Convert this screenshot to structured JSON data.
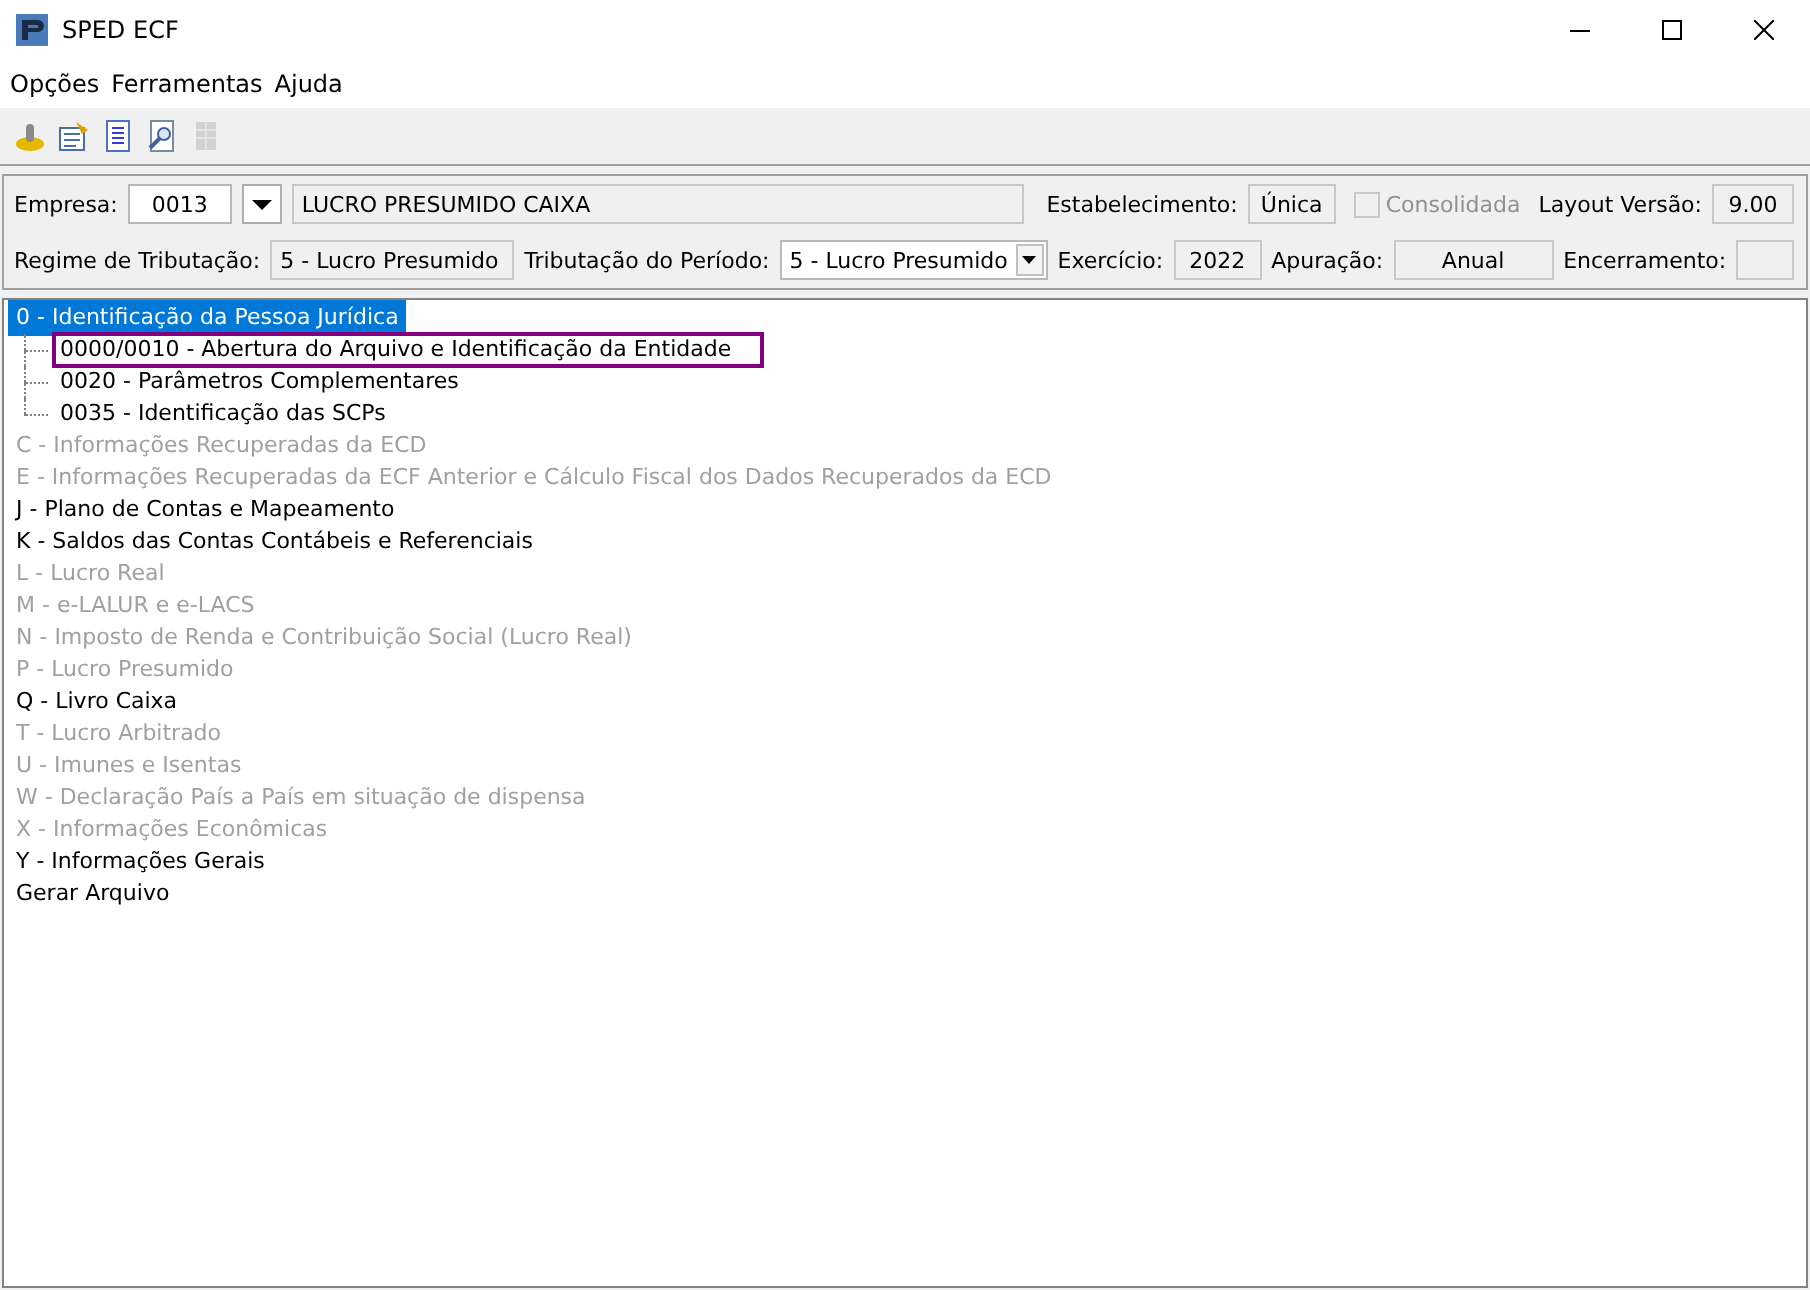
{
  "window": {
    "title": "SPED ECF"
  },
  "menu": [
    "Opções",
    "Ferramentas",
    "Ajuda"
  ],
  "toolbar": [
    {
      "disabled": false
    },
    {
      "disabled": false
    },
    {
      "disabled": false
    },
    {
      "disabled": false
    },
    {
      "disabled": true
    }
  ],
  "form": {
    "empresa": {
      "label": "Empresa:",
      "value": "0013"
    },
    "company_name": {
      "value": "LUCRO PRESUMIDO CAIXA"
    },
    "estabelecimento": {
      "label": "Estabelecimento:",
      "value": "Única"
    },
    "consolidada": {
      "label": "Consolidada",
      "checked": false,
      "disabled": true
    },
    "layout_versao": {
      "label": "Layout Versão:",
      "value": "9.00"
    },
    "regime": {
      "label": "Regime de Tributação:",
      "value": "5 - Lucro Presumido"
    },
    "tributacao_periodo": {
      "label": "Tributação do Período:",
      "value": "5 - Lucro Presumido"
    },
    "exercicio": {
      "label": "Exercício:",
      "value": "2022"
    },
    "apuracao": {
      "label": "Apuração:",
      "value": "Anual"
    },
    "encerramento": {
      "label": "Encerramento:"
    }
  },
  "tree": [
    {
      "label": "0 - Identificação da Pessoa Jurídica",
      "selected": true,
      "disabled": false,
      "children": [
        {
          "label": "0000/0010 - Abertura do Arquivo e Identificação da Entidade",
          "selected": false,
          "disabled": false,
          "outlined": true
        },
        {
          "label": "0020 - Parâmetros Complementares",
          "selected": false,
          "disabled": false,
          "outlined": false
        },
        {
          "label": "0035 - Identificação das SCPs",
          "selected": false,
          "disabled": false,
          "outlined": false
        }
      ]
    },
    {
      "label": "C - Informações Recuperadas da ECD",
      "selected": false,
      "disabled": true
    },
    {
      "label": "E - Informações Recuperadas da ECF Anterior e Cálculo Fiscal dos Dados Recuperados da ECD",
      "selected": false,
      "disabled": true
    },
    {
      "label": "J - Plano de Contas e Mapeamento",
      "selected": false,
      "disabled": false
    },
    {
      "label": "K - Saldos das Contas Contábeis e Referenciais",
      "selected": false,
      "disabled": false
    },
    {
      "label": "L - Lucro Real",
      "selected": false,
      "disabled": true
    },
    {
      "label": "M - e-LALUR e e-LACS",
      "selected": false,
      "disabled": true
    },
    {
      "label": "N - Imposto de Renda e Contribuição Social (Lucro Real)",
      "selected": false,
      "disabled": true
    },
    {
      "label": "P - Lucro Presumido",
      "selected": false,
      "disabled": true
    },
    {
      "label": "Q - Livro Caixa",
      "selected": false,
      "disabled": false
    },
    {
      "label": "T - Lucro Arbitrado",
      "selected": false,
      "disabled": true
    },
    {
      "label": "U - Imunes e Isentas",
      "selected": false,
      "disabled": true
    },
    {
      "label": "W - Declaração País a País em situação de dispensa",
      "selected": false,
      "disabled": true
    },
    {
      "label": "X - Informações Econômicas",
      "selected": false,
      "disabled": true
    },
    {
      "label": "Y - Informações Gerais",
      "selected": false,
      "disabled": false
    },
    {
      "label": "Gerar Arquivo",
      "selected": false,
      "disabled": false
    }
  ]
}
